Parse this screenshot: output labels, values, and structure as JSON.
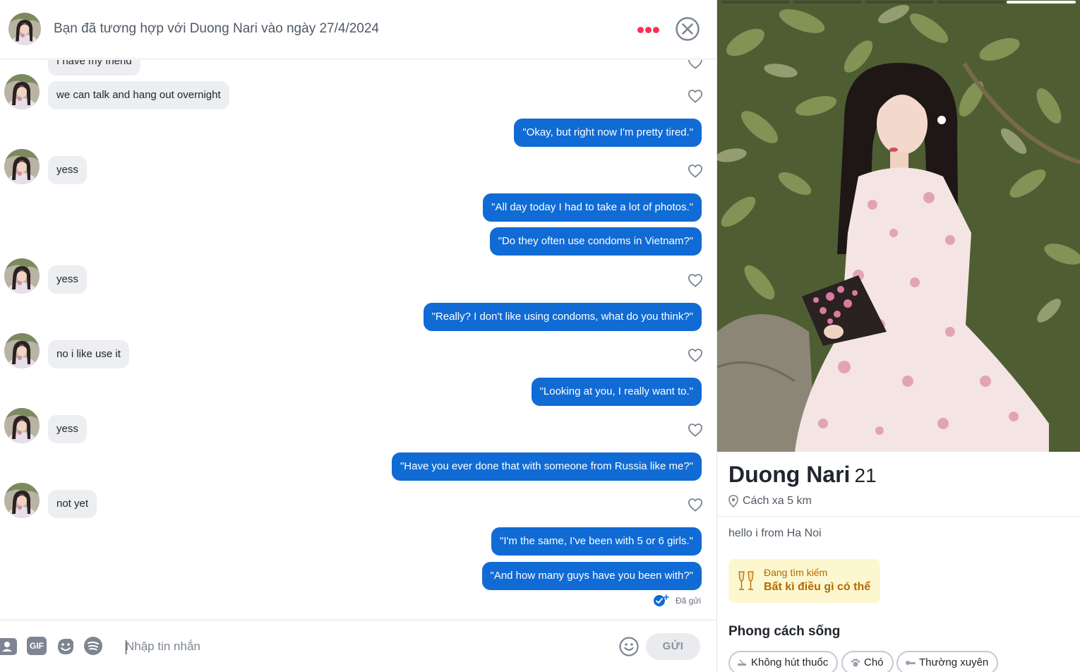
{
  "header": {
    "title": "Bạn đã tương hợp với Duong Nari vào ngày 27/4/2024"
  },
  "messages": [
    {
      "dir": "in",
      "text": "I have my friend"
    },
    {
      "dir": "in",
      "text": "we can talk and hang out overnight"
    },
    {
      "dir": "out",
      "text": "\"Okay, but right now I'm pretty tired.\""
    },
    {
      "dir": "in",
      "text": "yess"
    },
    {
      "dir": "out",
      "text": "\"All day today I had to take a lot of photos.\""
    },
    {
      "dir": "out",
      "text": "\"Do they often use condoms in Vietnam?\""
    },
    {
      "dir": "in",
      "text": "yess"
    },
    {
      "dir": "out",
      "text": "\"Really? I don't like using condoms, what do you think?\""
    },
    {
      "dir": "in",
      "text": "no i like use it"
    },
    {
      "dir": "out",
      "text": "\"Looking at you, I really want to.\""
    },
    {
      "dir": "in",
      "text": "yess"
    },
    {
      "dir": "out",
      "text": "\"Have you ever done that with someone from Russia like me?\""
    },
    {
      "dir": "in",
      "text": "not yet"
    },
    {
      "dir": "out",
      "text": "\"I'm the same, I've been with 5 or 6 girls.\""
    },
    {
      "dir": "out",
      "text": "\"And how many guys have you been with?\""
    }
  ],
  "sent_status": "Đã gửi",
  "composer": {
    "placeholder": "Nhập tin nhắn",
    "gif_label": "GIF",
    "send_label": "GỬI"
  },
  "profile": {
    "name": "Duong Nari",
    "age": "21",
    "distance": "Cách xa 5 km",
    "bio": "hello i from Ha Noi",
    "looking_for_label": "Đang tìm kiếm",
    "looking_for_value": "Bất kì điều gì có thể",
    "lifestyle_title": "Phong cách sống",
    "lifestyle_chips": [
      "Không hút thuốc",
      "Chó",
      "Thường xuyên"
    ],
    "photo_count": 5,
    "active_photo": 5
  },
  "colors": {
    "outgoing_bubble": "#106bd5",
    "incoming_bubble": "#eceef1",
    "brand_accent": "#fd2f56",
    "looking_bg": "#fdf7cf",
    "looking_text": "#b26a00"
  }
}
